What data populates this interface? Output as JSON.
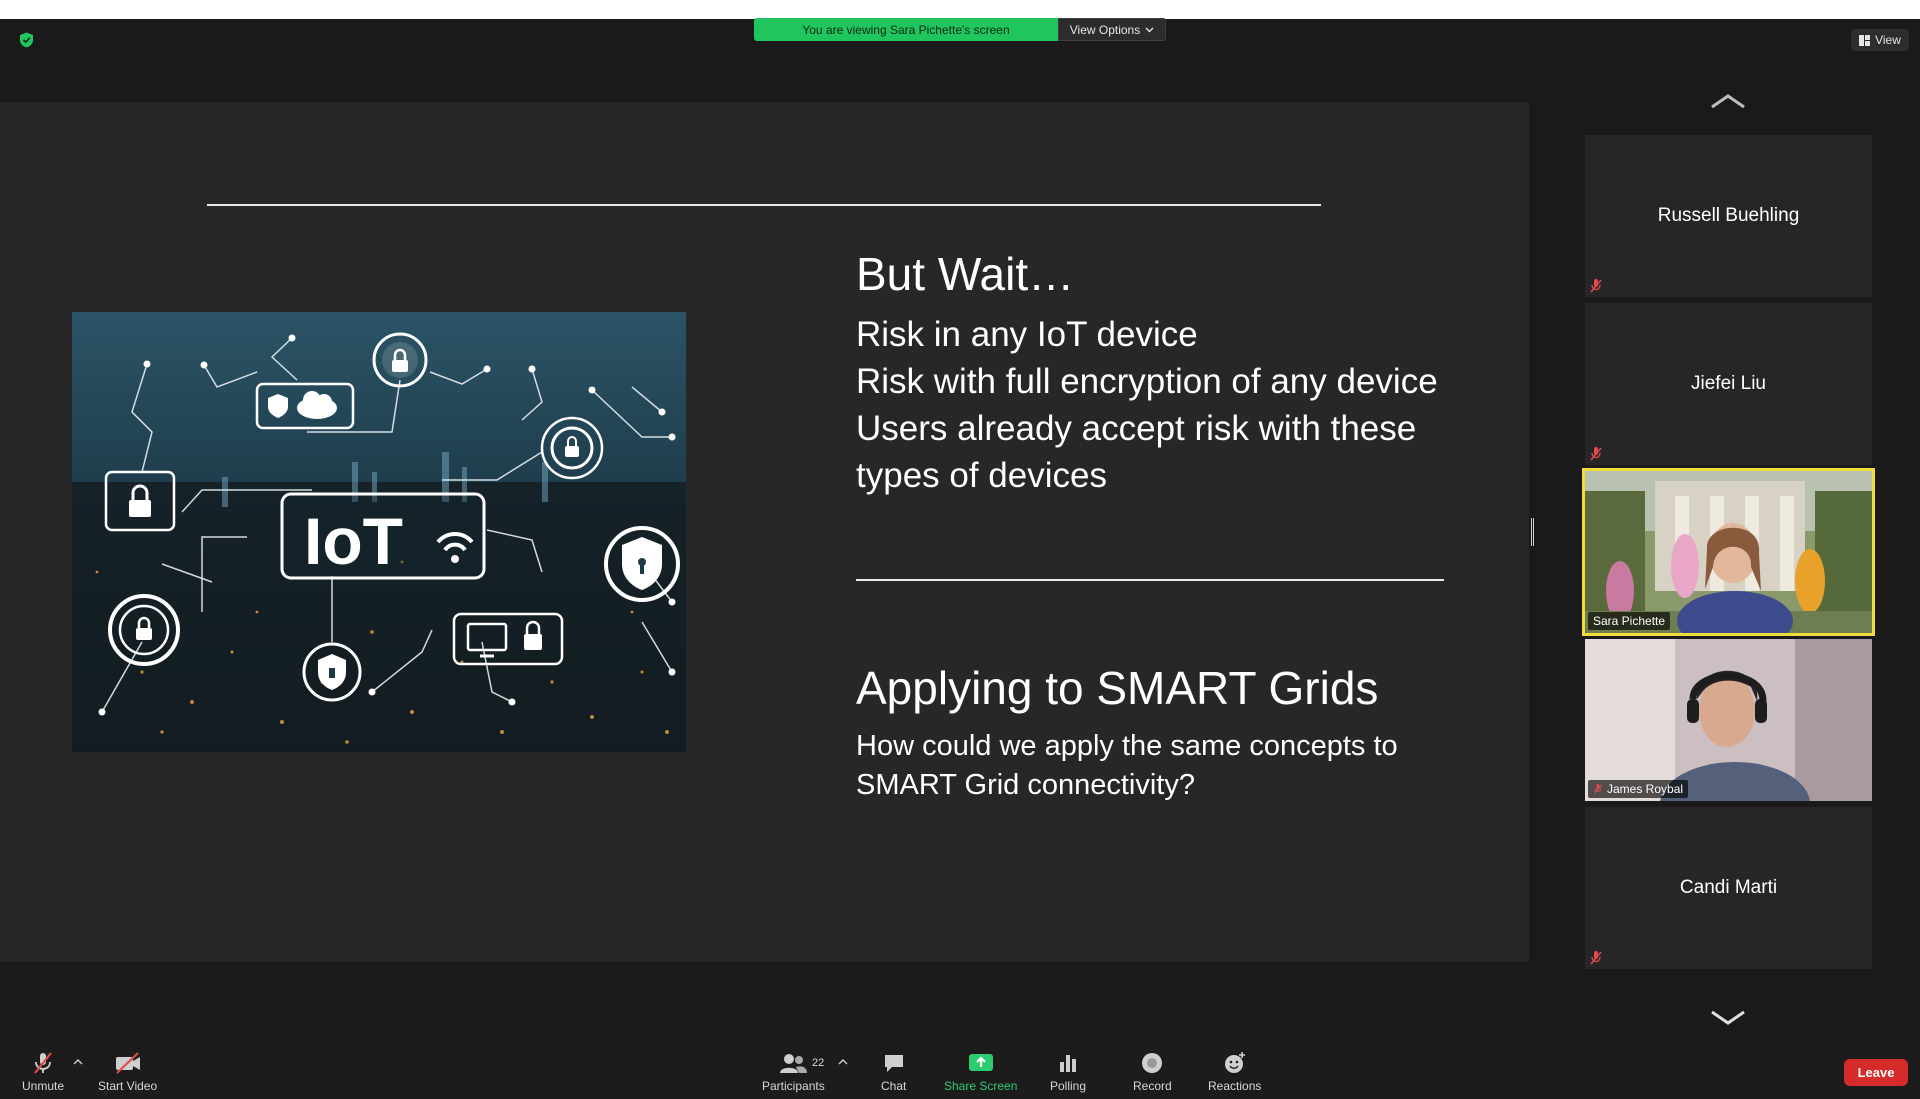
{
  "banner": {
    "viewing_text": "You are viewing Sara Pichette's screen",
    "view_options_label": "View Options"
  },
  "view_button": {
    "label": "View"
  },
  "slide": {
    "section1_title": "But Wait…",
    "bullets": [
      "Risk in any IoT device",
      "Risk with full encryption of any device",
      "Users already accept risk with these types of devices"
    ],
    "image_label": "IoT",
    "section2_title": "Applying to SMART Grids",
    "section2_body": "How could we apply the same concepts to SMART Grid connectivity?"
  },
  "participants_panel": {
    "tiles": [
      {
        "name": "Russell Buehling",
        "type": "name",
        "muted": true
      },
      {
        "name": "Jiefei Liu",
        "type": "name",
        "muted": true
      },
      {
        "name": "Sara Pichette",
        "type": "video",
        "muted": false,
        "active_speaker": true
      },
      {
        "name": "James Roybal",
        "type": "video",
        "muted": true
      },
      {
        "name": "Candi Marti",
        "type": "name",
        "muted": true
      }
    ]
  },
  "toolbar": {
    "unmute_label": "Unmute",
    "start_video_label": "Start Video",
    "participants_label": "Participants",
    "participants_count": "22",
    "chat_label": "Chat",
    "share_screen_label": "Share Screen",
    "polling_label": "Polling",
    "record_label": "Record",
    "reactions_label": "Reactions",
    "leave_label": "Leave"
  },
  "colors": {
    "banner_green": "#21c55d",
    "active_speaker_border": "#f0dc3a",
    "leave_red": "#d62b2b",
    "share_green": "#2ecc71",
    "slide_bg": "#27272a"
  }
}
